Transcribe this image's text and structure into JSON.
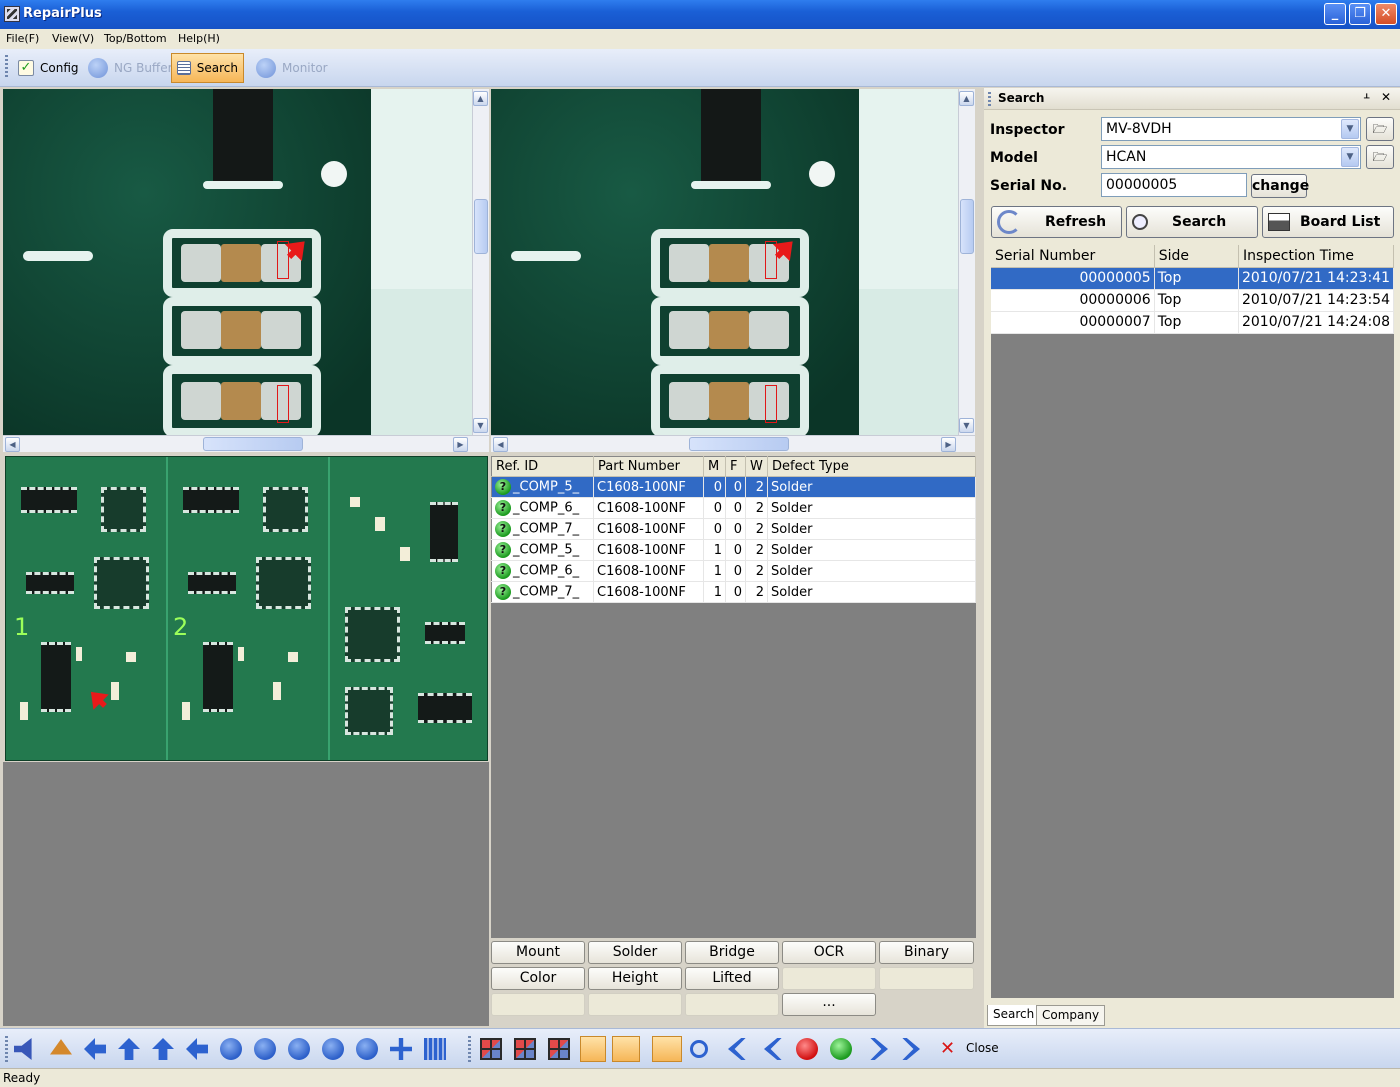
{
  "window": {
    "title": "RepairPlus",
    "minimize": "_",
    "restore": "❐",
    "close": "✕"
  },
  "menu": [
    "File(F)",
    "View(V)",
    "Top/Bottom",
    "Help(H)"
  ],
  "toolbar": {
    "config": "Config",
    "ng_buffer": "NG Buffer",
    "search": "Search",
    "monitor": "Monitor"
  },
  "board": {
    "panel_labels": [
      "1",
      "2"
    ]
  },
  "defects": {
    "columns": [
      "Ref. ID",
      "Part Number",
      "M",
      "F",
      "W",
      "Defect Type"
    ],
    "status_icon": "?",
    "rows": [
      {
        "ref": "_COMP_5_",
        "part": "C1608-100NF",
        "m": "0",
        "f": "0",
        "w": "2",
        "type": "Solder",
        "selected": true
      },
      {
        "ref": "_COMP_6_",
        "part": "C1608-100NF",
        "m": "0",
        "f": "0",
        "w": "2",
        "type": "Solder"
      },
      {
        "ref": "_COMP_7_",
        "part": "C1608-100NF",
        "m": "0",
        "f": "0",
        "w": "2",
        "type": "Solder"
      },
      {
        "ref": "_COMP_5_",
        "part": "C1608-100NF",
        "m": "1",
        "f": "0",
        "w": "2",
        "type": "Solder"
      },
      {
        "ref": "_COMP_6_",
        "part": "C1608-100NF",
        "m": "1",
        "f": "0",
        "w": "2",
        "type": "Solder"
      },
      {
        "ref": "_COMP_7_",
        "part": "C1608-100NF",
        "m": "1",
        "f": "0",
        "w": "2",
        "type": "Solder"
      }
    ]
  },
  "defect_buttons": {
    "mount": "Mount",
    "solder": "Solder",
    "bridge": "Bridge",
    "ocr": "OCR",
    "binary": "Binary",
    "color": "Color",
    "height": "Height",
    "lifted": "Lifted",
    "more": "..."
  },
  "search_panel": {
    "title": "Search",
    "pin": "ᚆ",
    "close": "✕",
    "inspector_label": "Inspector",
    "inspector_value": "MV-8VDH",
    "model_label": "Model",
    "model_value": "HCAN",
    "serial_label": "Serial No.",
    "serial_value": "00000005",
    "change_label": "change",
    "refresh_label": "Refresh",
    "search_label": "Search",
    "board_list_label": "Board List",
    "columns": [
      "Serial Number",
      "Side",
      "Inspection Time"
    ],
    "rows": [
      {
        "serial": "00000005",
        "side": "Top",
        "time": "2010/07/21 14:23:41",
        "selected": true
      },
      {
        "serial": "00000006",
        "side": "Top",
        "time": "2010/07/21 14:23:54"
      },
      {
        "serial": "00000007",
        "side": "Top",
        "time": "2010/07/21 14:24:08"
      }
    ],
    "tabs": [
      "Search",
      "Company"
    ]
  },
  "bottom_toolbar": {
    "close_label": "Close"
  },
  "status": {
    "text": "Ready"
  },
  "colors": {
    "selection": "#316ac5",
    "titlebar": "#1a5fd6",
    "pcb": "#0d3f2f"
  }
}
